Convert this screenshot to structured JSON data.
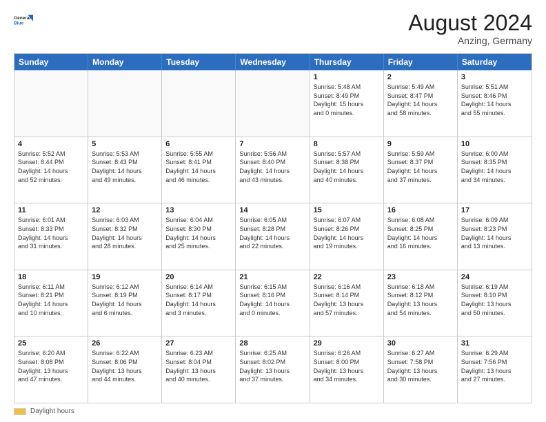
{
  "logo": {
    "general": "General",
    "blue": "Blue"
  },
  "title": "August 2024",
  "location": "Anzing, Germany",
  "header_days": [
    "Sunday",
    "Monday",
    "Tuesday",
    "Wednesday",
    "Thursday",
    "Friday",
    "Saturday"
  ],
  "footer": {
    "label": "Daylight hours"
  },
  "weeks": [
    [
      {
        "day": "",
        "info": ""
      },
      {
        "day": "",
        "info": ""
      },
      {
        "day": "",
        "info": ""
      },
      {
        "day": "",
        "info": ""
      },
      {
        "day": "1",
        "info": "Sunrise: 5:48 AM\nSunset: 8:49 PM\nDaylight: 15 hours\nand 0 minutes."
      },
      {
        "day": "2",
        "info": "Sunrise: 5:49 AM\nSunset: 8:47 PM\nDaylight: 14 hours\nand 58 minutes."
      },
      {
        "day": "3",
        "info": "Sunrise: 5:51 AM\nSunset: 8:46 PM\nDaylight: 14 hours\nand 55 minutes."
      }
    ],
    [
      {
        "day": "4",
        "info": "Sunrise: 5:52 AM\nSunset: 8:44 PM\nDaylight: 14 hours\nand 52 minutes."
      },
      {
        "day": "5",
        "info": "Sunrise: 5:53 AM\nSunset: 8:43 PM\nDaylight: 14 hours\nand 49 minutes."
      },
      {
        "day": "6",
        "info": "Sunrise: 5:55 AM\nSunset: 8:41 PM\nDaylight: 14 hours\nand 46 minutes."
      },
      {
        "day": "7",
        "info": "Sunrise: 5:56 AM\nSunset: 8:40 PM\nDaylight: 14 hours\nand 43 minutes."
      },
      {
        "day": "8",
        "info": "Sunrise: 5:57 AM\nSunset: 8:38 PM\nDaylight: 14 hours\nand 40 minutes."
      },
      {
        "day": "9",
        "info": "Sunrise: 5:59 AM\nSunset: 8:37 PM\nDaylight: 14 hours\nand 37 minutes."
      },
      {
        "day": "10",
        "info": "Sunrise: 6:00 AM\nSunset: 8:35 PM\nDaylight: 14 hours\nand 34 minutes."
      }
    ],
    [
      {
        "day": "11",
        "info": "Sunrise: 6:01 AM\nSunset: 8:33 PM\nDaylight: 14 hours\nand 31 minutes."
      },
      {
        "day": "12",
        "info": "Sunrise: 6:03 AM\nSunset: 8:32 PM\nDaylight: 14 hours\nand 28 minutes."
      },
      {
        "day": "13",
        "info": "Sunrise: 6:04 AM\nSunset: 8:30 PM\nDaylight: 14 hours\nand 25 minutes."
      },
      {
        "day": "14",
        "info": "Sunrise: 6:05 AM\nSunset: 8:28 PM\nDaylight: 14 hours\nand 22 minutes."
      },
      {
        "day": "15",
        "info": "Sunrise: 6:07 AM\nSunset: 8:26 PM\nDaylight: 14 hours\nand 19 minutes."
      },
      {
        "day": "16",
        "info": "Sunrise: 6:08 AM\nSunset: 8:25 PM\nDaylight: 14 hours\nand 16 minutes."
      },
      {
        "day": "17",
        "info": "Sunrise: 6:09 AM\nSunset: 8:23 PM\nDaylight: 14 hours\nand 13 minutes."
      }
    ],
    [
      {
        "day": "18",
        "info": "Sunrise: 6:11 AM\nSunset: 8:21 PM\nDaylight: 14 hours\nand 10 minutes."
      },
      {
        "day": "19",
        "info": "Sunrise: 6:12 AM\nSunset: 8:19 PM\nDaylight: 14 hours\nand 6 minutes."
      },
      {
        "day": "20",
        "info": "Sunrise: 6:14 AM\nSunset: 8:17 PM\nDaylight: 14 hours\nand 3 minutes."
      },
      {
        "day": "21",
        "info": "Sunrise: 6:15 AM\nSunset: 8:16 PM\nDaylight: 14 hours\nand 0 minutes."
      },
      {
        "day": "22",
        "info": "Sunrise: 6:16 AM\nSunset: 8:14 PM\nDaylight: 13 hours\nand 57 minutes."
      },
      {
        "day": "23",
        "info": "Sunrise: 6:18 AM\nSunset: 8:12 PM\nDaylight: 13 hours\nand 54 minutes."
      },
      {
        "day": "24",
        "info": "Sunrise: 6:19 AM\nSunset: 8:10 PM\nDaylight: 13 hours\nand 50 minutes."
      }
    ],
    [
      {
        "day": "25",
        "info": "Sunrise: 6:20 AM\nSunset: 8:08 PM\nDaylight: 13 hours\nand 47 minutes."
      },
      {
        "day": "26",
        "info": "Sunrise: 6:22 AM\nSunset: 8:06 PM\nDaylight: 13 hours\nand 44 minutes."
      },
      {
        "day": "27",
        "info": "Sunrise: 6:23 AM\nSunset: 8:04 PM\nDaylight: 13 hours\nand 40 minutes."
      },
      {
        "day": "28",
        "info": "Sunrise: 6:25 AM\nSunset: 8:02 PM\nDaylight: 13 hours\nand 37 minutes."
      },
      {
        "day": "29",
        "info": "Sunrise: 6:26 AM\nSunset: 8:00 PM\nDaylight: 13 hours\nand 34 minutes."
      },
      {
        "day": "30",
        "info": "Sunrise: 6:27 AM\nSunset: 7:58 PM\nDaylight: 13 hours\nand 30 minutes."
      },
      {
        "day": "31",
        "info": "Sunrise: 6:29 AM\nSunset: 7:56 PM\nDaylight: 13 hours\nand 27 minutes."
      }
    ]
  ]
}
